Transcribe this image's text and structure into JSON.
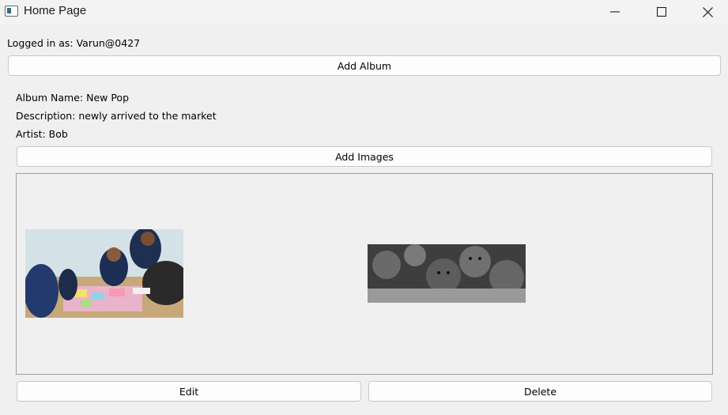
{
  "window": {
    "title": "Home Page",
    "icon": "app-window-icon",
    "controls": [
      "minimize-icon",
      "maximize-icon",
      "close-icon"
    ]
  },
  "user": {
    "logged_in_text": "Logged in as: Varun@0427"
  },
  "toolbar": {
    "add_album_label": "Add Album"
  },
  "album": {
    "name_text": "Album Name: New Pop",
    "description_text": "Description: newly arrived to the market",
    "artist_text": "Artist: Bob",
    "add_images_label": "Add Images",
    "images": [
      {
        "subject": "group of young people working around a table with colorful sticky notes"
      },
      {
        "subject": "black and white photo of children's faces"
      }
    ]
  },
  "actions": {
    "edit_label": "Edit",
    "delete_label": "Delete"
  }
}
